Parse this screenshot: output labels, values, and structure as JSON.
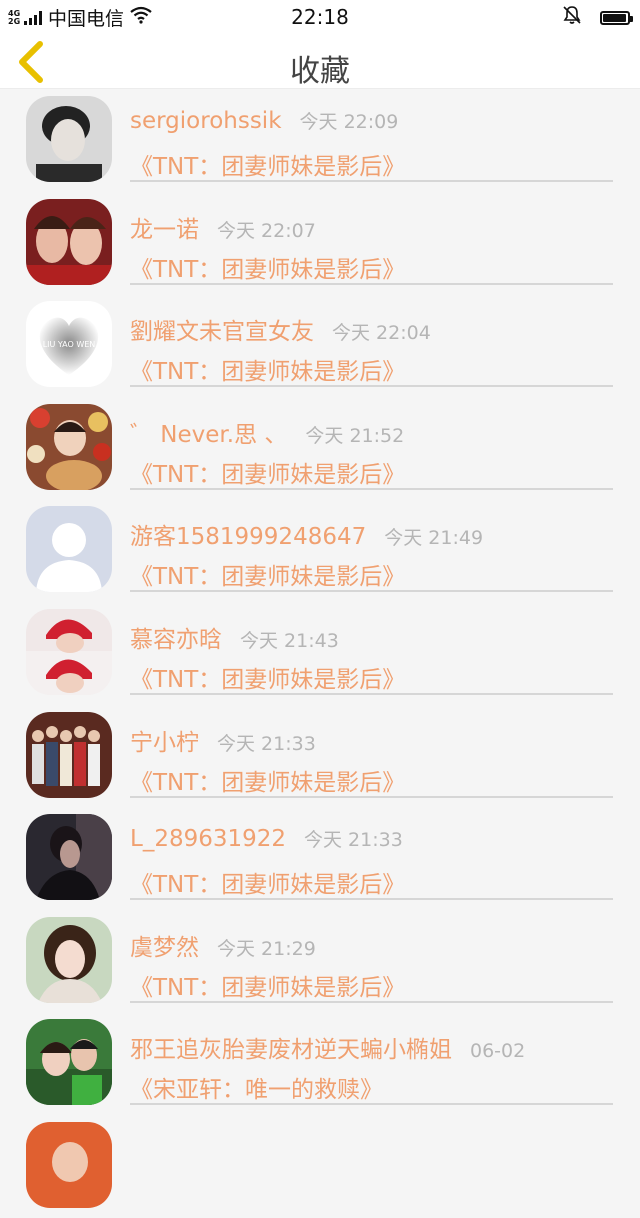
{
  "status_bar": {
    "network": "4G 2G",
    "carrier": "中国电信",
    "time": "22:18",
    "icons": [
      "signal-icon",
      "wifi-icon",
      "bell-muted-icon",
      "battery-icon"
    ],
    "battery_level": 0.95
  },
  "header": {
    "title": "收藏",
    "back_icon": "chevron-left-icon"
  },
  "colors": {
    "accent": "#f0a070",
    "back_icon": "#e8c000",
    "timestamp": "#b5b5b5",
    "divider": "#d6d6d6"
  },
  "favorites": [
    {
      "user": "sergiorohssik",
      "time": "今天 22:09",
      "book": "《TNT：团妻师妹是影后》"
    },
    {
      "user": "龙一诺",
      "time": "今天 22:07",
      "book": "《TNT：团妻师妹是影后》"
    },
    {
      "user": "劉耀文未官宣女友",
      "time": "今天 22:04",
      "book": "《TNT：团妻师妹是影后》",
      "avatar_text": "LIU YAO WEN"
    },
    {
      "user": "゛ Never.思 、",
      "time": "今天 21:52",
      "book": "《TNT：团妻师妹是影后》"
    },
    {
      "user": "游客1581999248647",
      "time": "今天 21:49",
      "book": "《TNT：团妻师妹是影后》"
    },
    {
      "user": "慕容亦晗",
      "time": "今天 21:43",
      "book": "《TNT：团妻师妹是影后》"
    },
    {
      "user": "宁小柠",
      "time": "今天 21:33",
      "book": "《TNT：团妻师妹是影后》"
    },
    {
      "user": "L_289631922",
      "time": "今天 21:33",
      "book": "《TNT：团妻师妹是影后》"
    },
    {
      "user": "虞梦然",
      "time": "今天 21:29",
      "book": "《TNT：团妻师妹是影后》"
    },
    {
      "user": "邪王追灰胎妻废材逆天蝙小椭姐",
      "time": "06-02",
      "book": "《宋亚轩：唯一的救赎》"
    }
  ]
}
